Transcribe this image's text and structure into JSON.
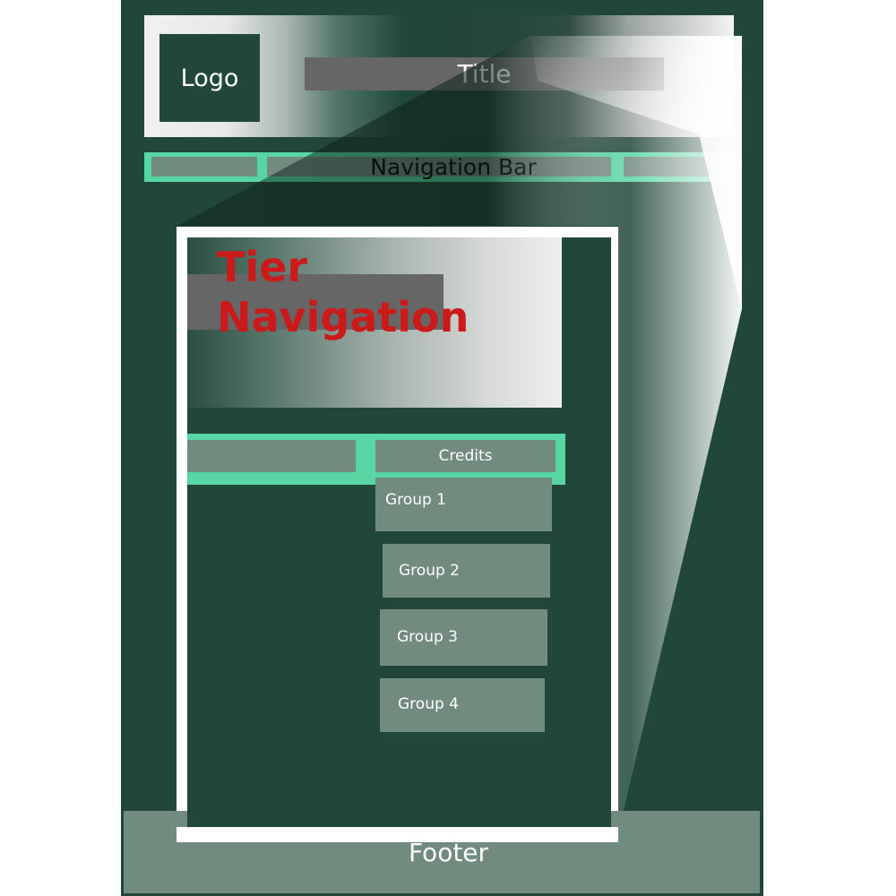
{
  "header": {
    "logo_label": "Logo",
    "title_label": "Title"
  },
  "navigation": {
    "label": "Navigation Bar"
  },
  "tier": {
    "title": "Tier Navigation",
    "credits_label": "Credits",
    "groups": [
      "Group 1",
      "Group 2",
      "Group 3",
      "Group 4"
    ]
  },
  "footer": {
    "label": "Footer"
  },
  "colors": {
    "frame": "#20473a",
    "accent": "#57d6a4",
    "slot": "#728b7f",
    "title_red": "#cc1a1a",
    "bar_gray": "#666666"
  }
}
